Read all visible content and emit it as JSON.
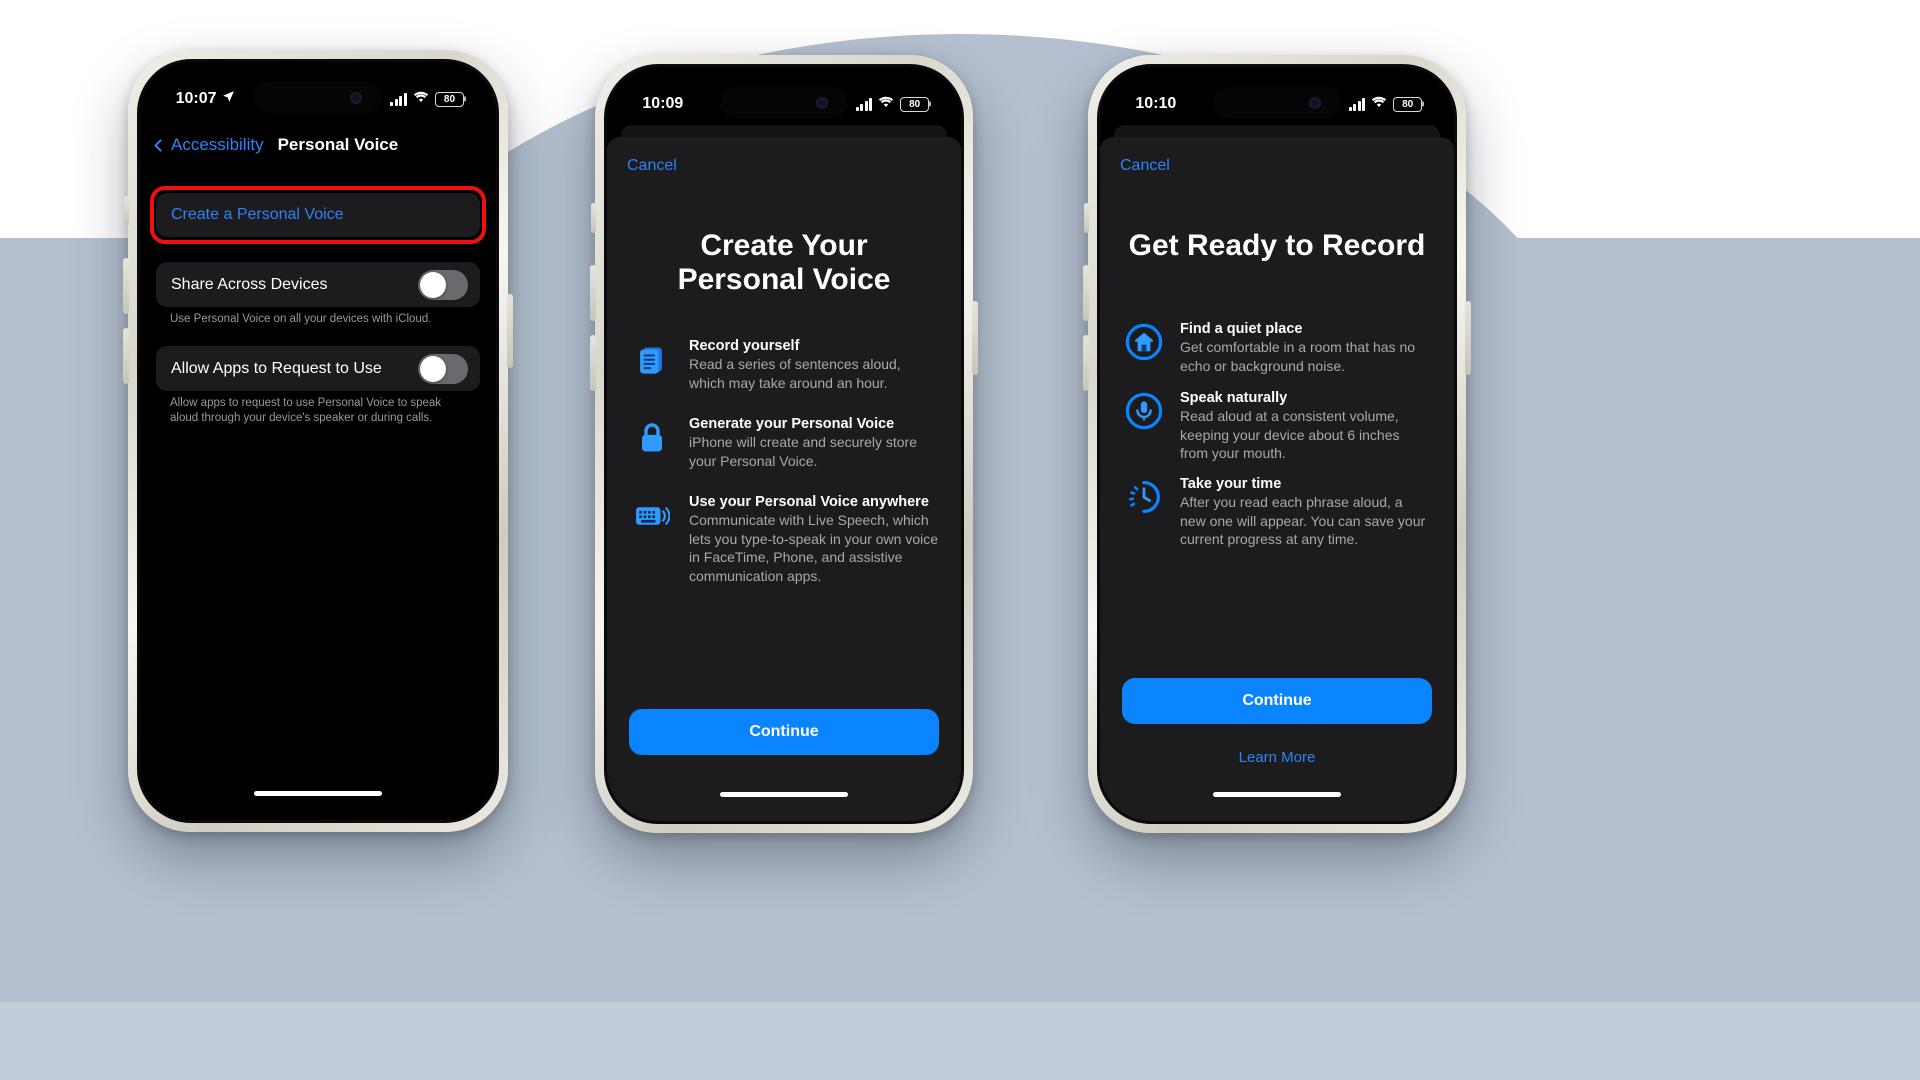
{
  "scene": {
    "background_color": "#b4c0cf",
    "page_background": "#ffffff"
  },
  "phones": [
    {
      "id": "phone-settings",
      "status_bar": {
        "time": "10:07",
        "location_icon": "location-arrow-icon",
        "signal_icon": "cellular-bars-icon",
        "wifi_icon": "wifi-icon",
        "battery_level": "80"
      },
      "nav": {
        "back_label": "Accessibility",
        "title": "Personal Voice"
      },
      "rows": [
        {
          "label": "Create a Personal Voice",
          "type": "link",
          "highlighted": true
        },
        {
          "label": "Share Across Devices",
          "type": "toggle",
          "value": "off",
          "footnote": "Use Personal Voice on all your devices with iCloud."
        },
        {
          "label": "Allow Apps to Request to Use",
          "type": "toggle",
          "value": "off",
          "footnote": "Allow apps to request to use Personal Voice to speak aloud through your device's speaker or during calls."
        }
      ],
      "highlight_color": "#f10f0f"
    },
    {
      "id": "phone-create",
      "status_bar": {
        "time": "10:09",
        "signal_icon": "cellular-bars-icon",
        "wifi_icon": "wifi-icon",
        "battery_level": "80"
      },
      "sheet": {
        "cancel_label": "Cancel",
        "title_line1": "Create Your",
        "title_line2": "Personal Voice",
        "features": [
          {
            "icon": "document-lines-icon",
            "title": "Record yourself",
            "desc": "Read a series of sentences aloud, which may take around an hour."
          },
          {
            "icon": "lock-icon",
            "title": "Generate your Personal Voice",
            "desc": "iPhone will create and securely store your Personal Voice."
          },
          {
            "icon": "keyboard-speak-icon",
            "title": "Use your Personal Voice anywhere",
            "desc": "Communicate with Live Speech, which lets you type-to-speak in your own voice in FaceTime, Phone, and assistive communication apps."
          }
        ],
        "primary_button": "Continue"
      }
    },
    {
      "id": "phone-ready",
      "status_bar": {
        "time": "10:10",
        "signal_icon": "cellular-bars-icon",
        "wifi_icon": "wifi-icon",
        "battery_level": "80"
      },
      "sheet": {
        "cancel_label": "Cancel",
        "title_line1": "Get Ready to Record",
        "title_line2": "",
        "features": [
          {
            "icon": "home-circle-icon",
            "title": "Find a quiet place",
            "desc": "Get comfortable in a room that has no echo or background noise."
          },
          {
            "icon": "microphone-circle-icon",
            "title": "Speak naturally",
            "desc": "Read aloud at a consistent volume, keeping your device about 6 inches from your mouth."
          },
          {
            "icon": "timer-icon",
            "title": "Take your time",
            "desc": "After you read each phrase aloud, a new one will appear. You can save your current progress at any time."
          }
        ],
        "primary_button": "Continue",
        "secondary_link": "Learn More"
      }
    }
  ],
  "colors": {
    "accent_blue": "#0a84ff",
    "link_blue": "#2f82f7",
    "cell_bg": "#1c1c1e",
    "footnote_gray": "#98989e",
    "desc_gray": "#a8a8ae"
  }
}
